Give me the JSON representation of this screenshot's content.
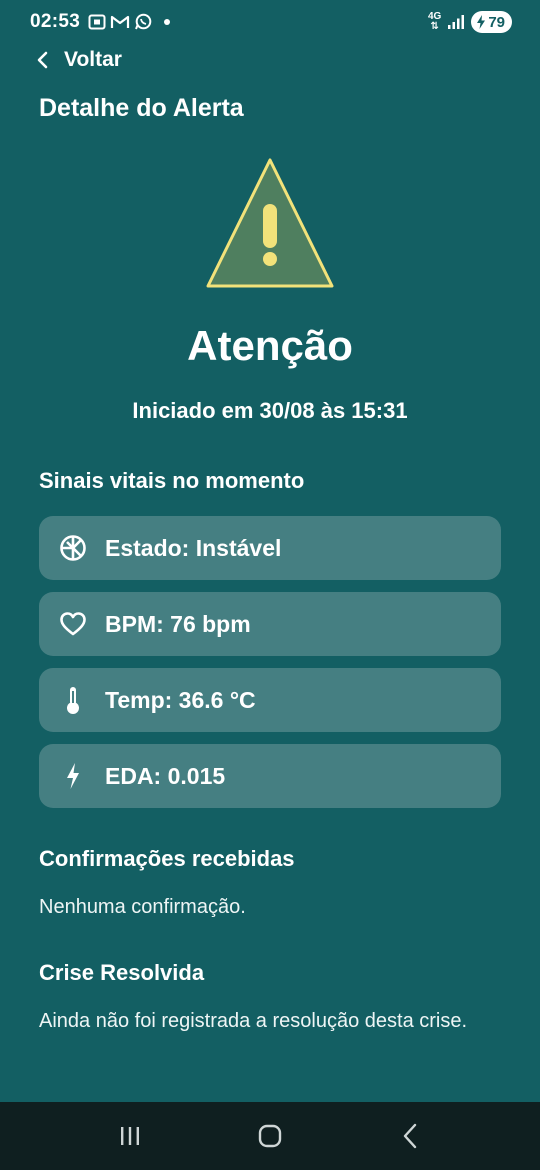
{
  "status_bar": {
    "time": "02:53",
    "network": "4G",
    "battery": "79"
  },
  "header": {
    "back_label": "Voltar",
    "title": "Detalhe do Alerta"
  },
  "alert": {
    "level": "Atenção",
    "started": "Iniciado em 30/08 às 15:31",
    "icon": "warning-triangle-icon",
    "icon_fill": "#4f7f5f",
    "icon_stroke": "#f2e27a"
  },
  "vitals": {
    "title": "Sinais vitais no momento",
    "items": [
      {
        "icon": "state-icon",
        "label": "Estado: Instável"
      },
      {
        "icon": "heart-icon",
        "label": "BPM: 76 bpm"
      },
      {
        "icon": "thermometer-icon",
        "label": "Temp: 36.6 °C"
      },
      {
        "icon": "bolt-icon",
        "label": "EDA: 0.015"
      }
    ]
  },
  "confirmations": {
    "title": "Confirmações recebidas",
    "text": "Nenhuma confirmação."
  },
  "resolution": {
    "title": "Crise Resolvida",
    "text": "Ainda não foi registrada a resolução desta crise."
  },
  "colors": {
    "background": "#135f63",
    "card": "#457f82",
    "nav_bar": "#0f1f20"
  }
}
